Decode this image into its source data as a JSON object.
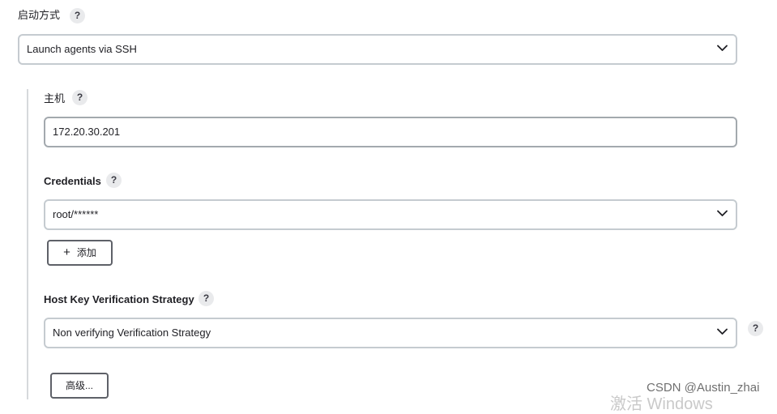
{
  "launch_method": {
    "label": "启动方式",
    "help": "?",
    "selected": "Launch agents via SSH"
  },
  "host": {
    "label": "主机",
    "help": "?",
    "value": "172.20.30.201"
  },
  "credentials": {
    "label": "Credentials",
    "help": "?",
    "selected": "root/******",
    "add_button": {
      "icon": "+",
      "label": "添加"
    }
  },
  "host_key": {
    "label": "Host Key Verification Strategy",
    "help": "?",
    "selected": "Non verifying Verification Strategy",
    "side_help": "?"
  },
  "advanced_button": {
    "label": "高级..."
  },
  "watermark": {
    "text": "CSDN @Austin_zhai"
  },
  "windows_activation": {
    "text": "激活 Windows"
  }
}
